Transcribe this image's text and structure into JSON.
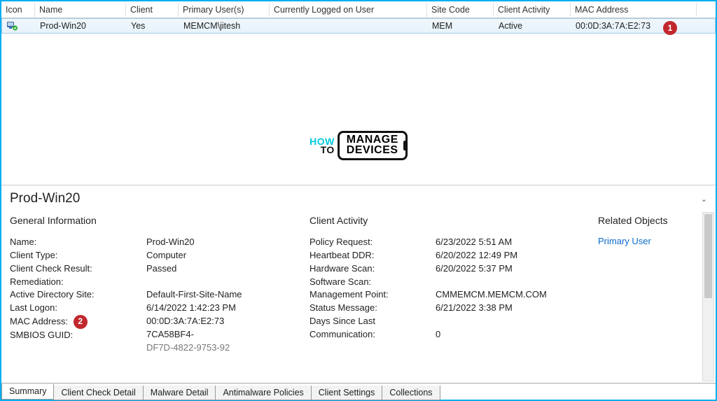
{
  "grid": {
    "headers": [
      "Icon",
      "Name",
      "Client",
      "Primary User(s)",
      "Currently Logged on User",
      "Site Code",
      "Client Activity",
      "MAC Address"
    ],
    "row": {
      "name": "Prod-Win20",
      "client": "Yes",
      "primaryUser": "MEMCM\\jitesh",
      "loggedOnUser": "",
      "siteCode": "MEM",
      "clientActivity": "Active",
      "macAddress": "00:0D:3A:7A:E2:73"
    },
    "badge1": "1"
  },
  "watermark": {
    "how": "HOW",
    "to": "TO",
    "manage": "MANAGE",
    "devices": "DEVICES"
  },
  "detail": {
    "title": "Prod-Win20",
    "sections": {
      "general": {
        "title": "General Information",
        "labels": {
          "name": "Name:",
          "clientType": "Client Type:",
          "clientCheckResult": "Client Check Result:",
          "remediation": "Remediation:",
          "adSite": "Active Directory Site:",
          "blank": " ",
          "lastLogon": "Last Logon:",
          "blank2": " ",
          "macAddress": "MAC Address:",
          "smbiosGuid": "SMBIOS GUID:"
        },
        "values": {
          "name": "Prod-Win20",
          "clientType": "Computer",
          "clientCheckResult": "Passed",
          "remediation": "",
          "adSite": "Default-First-Site-Name",
          "lastLogon": "6/14/2022 1:42:23 PM",
          "macAddress": "00:0D:3A:7A:E2:73",
          "smbiosGuid": "7CA58BF4-",
          "smbiosGuidCut": "DF7D-4822-9753-92"
        },
        "badge2": "2"
      },
      "activity": {
        "title": "Client Activity",
        "labels": {
          "policyRequest": "Policy Request:",
          "heartbeat": "Heartbeat DDR:",
          "hwScan": "Hardware Scan:",
          "swScan": "Software Scan:",
          "mgmtPoint": "Management Point:",
          "blank": " ",
          "statusMsg": "Status Message:",
          "daysSince": "Days Since Last",
          "communication": "Communication:"
        },
        "values": {
          "policyRequest": "6/23/2022 5:51 AM",
          "heartbeat": "6/20/2022 12:49 PM",
          "hwScan": "6/20/2022 5:37 PM",
          "swScan": "",
          "mgmtPoint": "CMMEMCM.MEMCM.COM",
          "statusMsg": "6/21/2022 3:38 PM",
          "daysSince": "",
          "communication": "0"
        }
      },
      "related": {
        "title": "Related Objects",
        "primaryUser": "Primary User"
      }
    }
  },
  "tabs": [
    "Summary",
    "Client Check Detail",
    "Malware Detail",
    "Antimalware Policies",
    "Client Settings",
    "Collections"
  ]
}
